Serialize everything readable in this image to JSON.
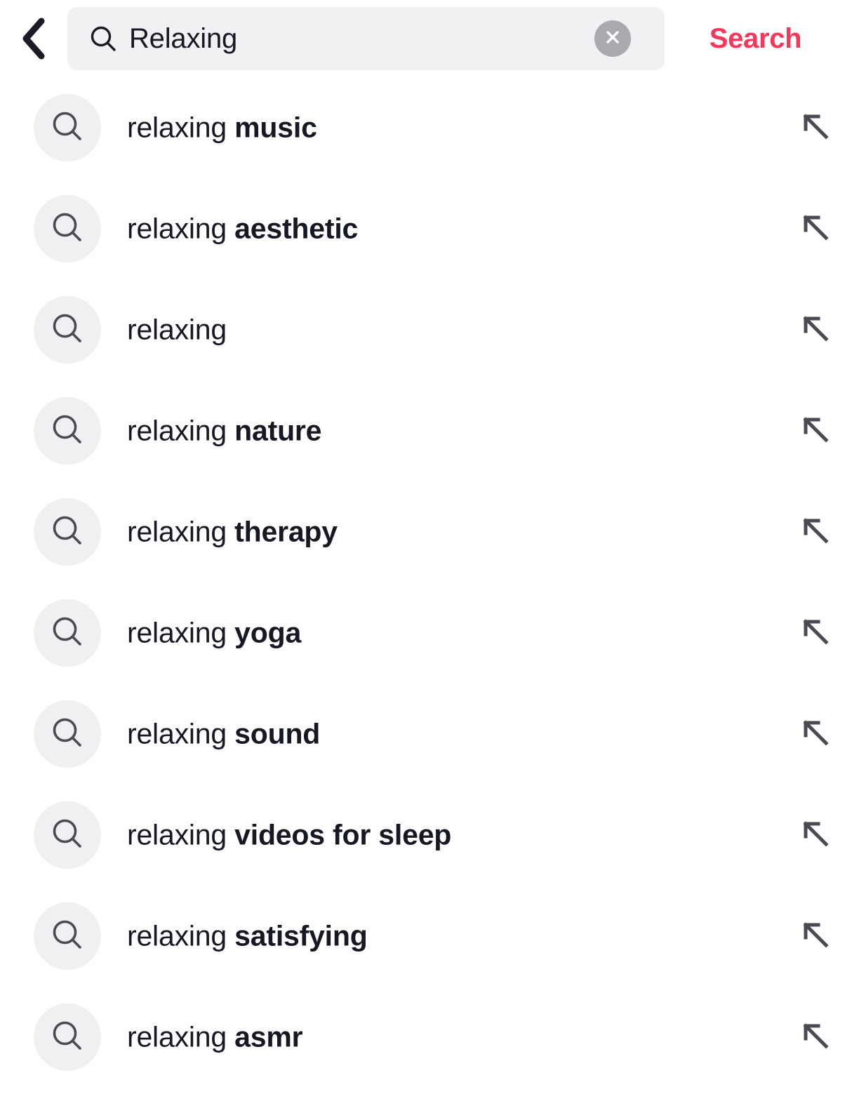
{
  "header": {
    "back_icon": "chevron-left-icon",
    "search_icon": "search-icon",
    "clear_icon": "close-icon",
    "query_value": "Relaxing",
    "query_placeholder": "Search",
    "search_button_label": "Search",
    "accent_color": "#F4375A",
    "field_background": "#F1F1F4",
    "clear_button_color": "#A9A9AF"
  },
  "suggestions": {
    "bubble_color": "#F0F0F3",
    "icon_color": "#4A4A52",
    "arrow_icon": "arrow-up-left-icon",
    "row_icon": "search-icon",
    "items": [
      {
        "prefix": "relaxing ",
        "bold": "music"
      },
      {
        "prefix": "relaxing ",
        "bold": "aesthetic"
      },
      {
        "prefix": "relaxing",
        "bold": ""
      },
      {
        "prefix": "relaxing ",
        "bold": "nature"
      },
      {
        "prefix": "relaxing ",
        "bold": "therapy"
      },
      {
        "prefix": "relaxing ",
        "bold": "yoga"
      },
      {
        "prefix": "relaxing ",
        "bold": "sound"
      },
      {
        "prefix": "relaxing ",
        "bold": "videos for sleep"
      },
      {
        "prefix": "relaxing ",
        "bold": "satisfying"
      },
      {
        "prefix": "relaxing ",
        "bold": "asmr"
      }
    ]
  }
}
